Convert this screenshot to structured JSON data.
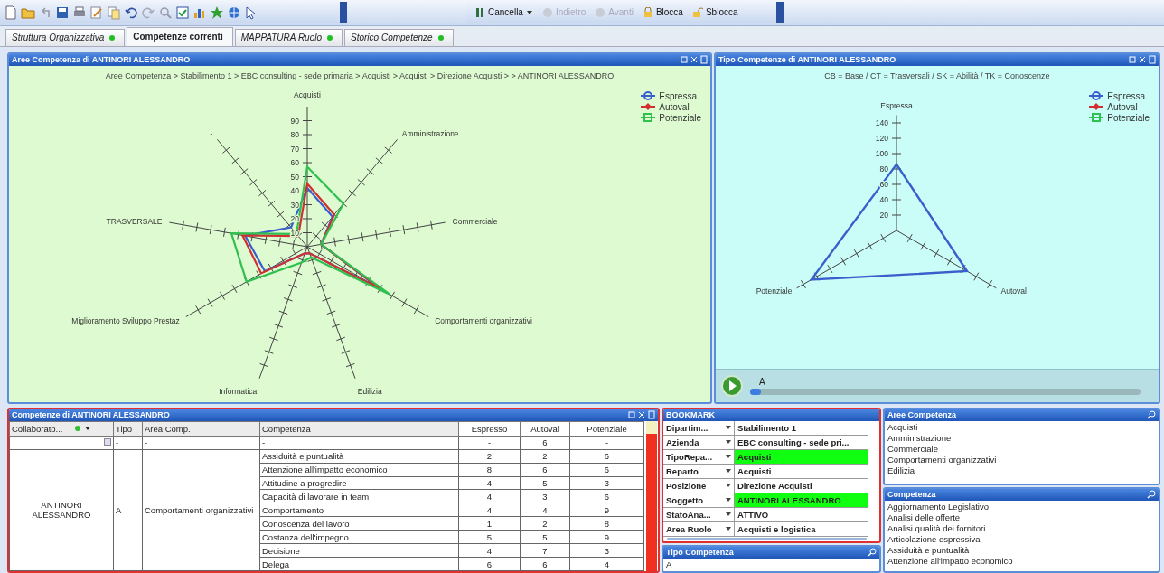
{
  "toolbar": {
    "buttons": [
      {
        "label": "Cancella",
        "kind": "dropdown",
        "disabled": false
      },
      {
        "label": "Indietro",
        "kind": "plain",
        "disabled": true
      },
      {
        "label": "Avanti",
        "kind": "plain",
        "disabled": true
      },
      {
        "label": "Blocca",
        "kind": "plain",
        "disabled": false
      },
      {
        "label": "Sblocca",
        "kind": "plain",
        "disabled": false
      }
    ]
  },
  "tabs": [
    {
      "label": "Struttura Organizzativa",
      "selected": false,
      "dot": true
    },
    {
      "label": "Competenze correnti",
      "selected": true,
      "dot": false
    },
    {
      "label": "MAPPATURA Ruolo",
      "selected": false,
      "dot": true
    },
    {
      "label": "Storico Competenze",
      "selected": false,
      "dot": true
    }
  ],
  "aree_panel": {
    "title": "Aree Competenza di ANTINORI ALESSANDRO",
    "breadcrumb": "Aree Competenza > Stabilimento 1 > EBC consulting - sede primaria > Acquisti > Acquisti > Direzione Acquisti >  > ANTINORI ALESSANDRO",
    "axes": [
      "Acquisti",
      "-",
      "Amministrazione",
      "TRASVERSALE",
      "Commerciale",
      "Miglioramento Sviluppo Prestaz",
      "Comportamenti organizzativi",
      "Informatica",
      "Edilizia"
    ],
    "ticks": [
      "90",
      "80",
      "70",
      "60",
      "50",
      "40",
      "30",
      "20",
      "10"
    ],
    "legend": [
      {
        "name": "Espressa",
        "color": "#3a5fcd"
      },
      {
        "name": "Autoval",
        "color": "#d03030"
      },
      {
        "name": "Potenziale",
        "color": "#30c050"
      }
    ]
  },
  "tipo_panel": {
    "title": "Tipo Competenze di ANTINORI ALESSANDRO",
    "subtitle": "CB = Base / CT = Trasversali / SK = Abilità / TK = Conoscenze",
    "axes": [
      "Espressa",
      "Potenziale",
      "Autoval"
    ],
    "ticks": [
      "140",
      "120",
      "100",
      "80",
      "60",
      "40",
      "20"
    ],
    "legend": [
      {
        "name": "Espressa",
        "color": "#3a5fcd"
      },
      {
        "name": "Autoval",
        "color": "#d03030"
      },
      {
        "name": "Potenziale",
        "color": "#30c050"
      }
    ],
    "player": {
      "label": "A",
      "level": 0.02
    }
  },
  "competenze_panel": {
    "title": "Competenze di ANTINORI ALESSANDRO",
    "columns": [
      "Collaborato...",
      "Tipo",
      "Area Comp.",
      "Competenza",
      "Espresso",
      "Autoval",
      "Potenziale"
    ],
    "filter_row": [
      "-",
      "-",
      "-",
      "-",
      "6",
      "-"
    ],
    "collaboratore": "ANTINORI ALESSANDRO",
    "tipo": "A",
    "area": "Comportamenti organizzativi",
    "rows": [
      {
        "competenza": "Assiduità e puntualità",
        "espresso": "2",
        "autoval": "2",
        "potenziale": "6"
      },
      {
        "competenza": "Attenzione all'impatto economico",
        "espresso": "8",
        "autoval": "6",
        "potenziale": "6"
      },
      {
        "competenza": "Attitudine a progredire",
        "espresso": "4",
        "autoval": "5",
        "potenziale": "3"
      },
      {
        "competenza": "Capacità di lavorare in team",
        "espresso": "4",
        "autoval": "3",
        "potenziale": "6"
      },
      {
        "competenza": "Comportamento",
        "espresso": "4",
        "autoval": "4",
        "potenziale": "9"
      },
      {
        "competenza": "Conoscenza del lavoro",
        "espresso": "1",
        "autoval": "2",
        "potenziale": "8"
      },
      {
        "competenza": "Costanza dell'impegno",
        "espresso": "5",
        "autoval": "5",
        "potenziale": "9"
      },
      {
        "competenza": "Decisione",
        "espresso": "4",
        "autoval": "7",
        "potenziale": "3"
      },
      {
        "competenza": "Delega",
        "espresso": "6",
        "autoval": "6",
        "potenziale": "4"
      }
    ]
  },
  "bookmark": {
    "title": "BOOKMARK",
    "rows": [
      {
        "field": "Dipartim...",
        "value": "Stabilimento 1",
        "selected": false
      },
      {
        "field": "Azienda",
        "value": "EBC consulting - sede pri...",
        "selected": false
      },
      {
        "field": "TipoRepa...",
        "value": "Acquisti",
        "selected": true
      },
      {
        "field": "Reparto",
        "value": "Acquisti",
        "selected": false
      },
      {
        "field": "Posizione",
        "value": "Direzione Acquisti",
        "selected": false
      },
      {
        "field": "Soggetto",
        "value": "ANTINORI ALESSANDRO",
        "selected": true
      },
      {
        "field": "StatoAna...",
        "value": "ATTIVO",
        "selected": false
      },
      {
        "field": "Area Ruolo",
        "value": "Acquisti e logistica",
        "selected": false
      }
    ]
  },
  "tipo_competenza": {
    "title": "Tipo Competenza",
    "items": [
      "A"
    ]
  },
  "aree_list": {
    "title": "Aree Competenza",
    "items": [
      "Acquisti",
      "Amministrazione",
      "Commerciale",
      "Comportamenti organizzativi",
      "Edilizia"
    ]
  },
  "competenza_list": {
    "title": "Competenza",
    "items": [
      "Aggiornamento Legislativo",
      "Analisi delle offerte",
      "Analisi qualità dei fornitori",
      "Articolazione espressiva",
      "Assiduità e puntualità",
      "Attenzione all'impatto economico"
    ]
  }
}
